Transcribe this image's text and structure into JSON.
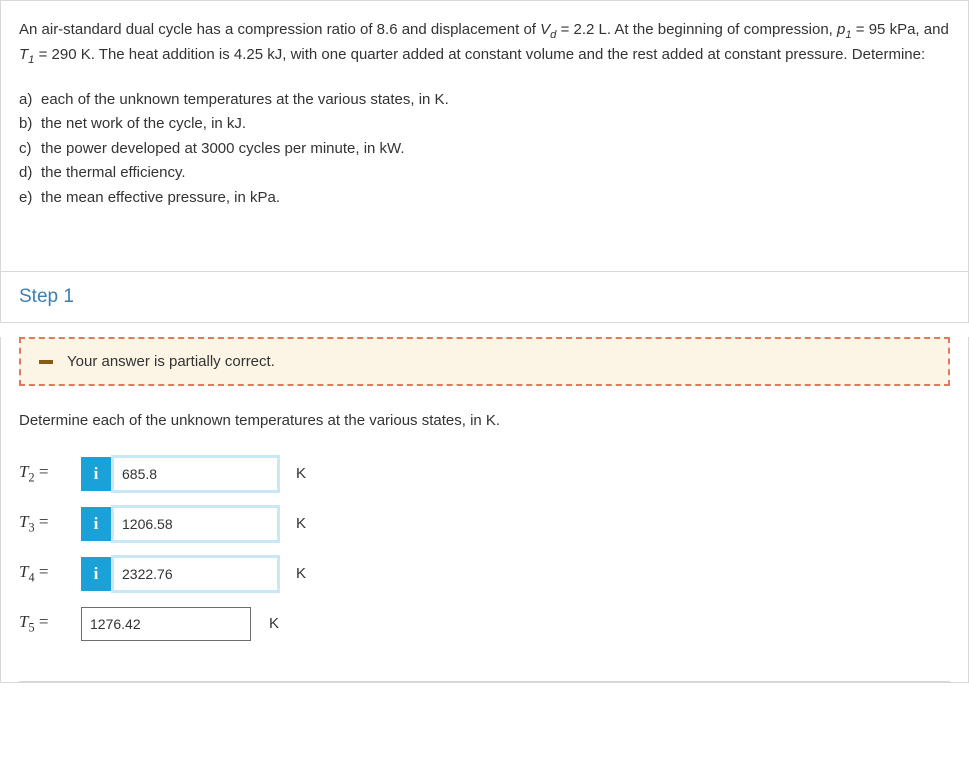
{
  "question": {
    "intro_html": "An air-standard dual cycle has a compression ratio of 8.6 and displacement of <span class='ital'>V<span class=\"sub\">d</span></span> = 2.2 L. At the beginning of compression, <span class='ital'>p<span class=\"sub\">1</span></span> = 95 kPa, and <span class='ital'>T<span class=\"sub\">1</span></span> = 290 K. The heat addition is 4.25 kJ, with one quarter added at constant volume and the rest added at constant pressure. Determine:",
    "parts": [
      {
        "lbl": "a)",
        "text": "each of the unknown temperatures at the various states, in K."
      },
      {
        "lbl": "b)",
        "text": "the net work of the cycle, in kJ."
      },
      {
        "lbl": "c)",
        "text": "the power developed at 3000 cycles per minute, in kW."
      },
      {
        "lbl": "d)",
        "text": "the thermal efficiency."
      },
      {
        "lbl": "e)",
        "text": "the mean effective pressure, in kPa."
      }
    ]
  },
  "step": {
    "title": "Step 1",
    "feedback": "Your answer is partially correct.",
    "prompt": "Determine each of the unknown temperatures at the various states, in K.",
    "answers": [
      {
        "var_html": "T<span class=\"sub\">2</span>",
        "eq": "=",
        "value": "685.8",
        "unit": "K",
        "has_info": true
      },
      {
        "var_html": "T<span class=\"sub\">3</span>",
        "eq": "=",
        "value": "1206.58",
        "unit": "K",
        "has_info": true
      },
      {
        "var_html": "T<span class=\"sub\">4</span>",
        "eq": "=",
        "value": "2322.76",
        "unit": "K",
        "has_info": true
      },
      {
        "var_html": "T<span class=\"sub\">5</span>",
        "eq": "=",
        "value": "1276.42",
        "unit": "K",
        "has_info": false
      }
    ]
  },
  "info_glyph": "i"
}
